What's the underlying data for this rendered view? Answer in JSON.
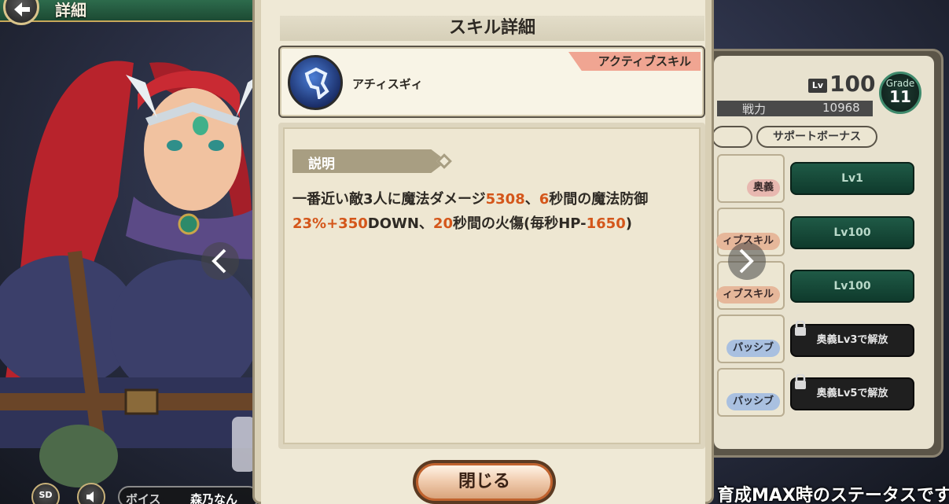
{
  "header": {
    "title": "詳細"
  },
  "modal": {
    "title": "スキル詳細",
    "skill": {
      "name": "アチィスギィ",
      "type": "アクティブスキル"
    },
    "description": {
      "header": "説明",
      "segments": [
        {
          "text": "一番近い敵3人に魔法ダメージ",
          "hl": false
        },
        {
          "text": "5308",
          "hl": true
        },
        {
          "text": "、",
          "hl": false
        },
        {
          "text": "6",
          "hl": true
        },
        {
          "text": "秒間の魔法防御",
          "hl": false
        },
        {
          "text": "23%+350",
          "hl": true
        },
        {
          "text": "DOWN、",
          "hl": false
        },
        {
          "text": "20",
          "hl": true
        },
        {
          "text": "秒間の火傷(毎秒HP-",
          "hl": false
        },
        {
          "text": "1650",
          "hl": true
        },
        {
          "text": ")",
          "hl": false
        }
      ]
    },
    "close_label": "閉じる"
  },
  "status": {
    "lv_tag": "Lv",
    "level": "100",
    "grade_label": "Grade",
    "grade": "11",
    "power_label": "戦力",
    "power": "10968",
    "tab_support": "サポートボーナス",
    "rows": [
      {
        "tag": "奥義",
        "tag_type": "ougi",
        "button": "Lv1",
        "locked": false
      },
      {
        "tag": "ィブスキル",
        "tag_type": "active",
        "button": "Lv100",
        "locked": false
      },
      {
        "tag": "ィブスキル",
        "tag_type": "active",
        "button": "Lv100",
        "locked": false
      },
      {
        "tag": "パッシブ",
        "tag_type": "passive",
        "button": "奥義Lv3で解放",
        "locked": true
      },
      {
        "tag": "パッシブ",
        "tag_type": "passive",
        "button": "奥義Lv5で解放",
        "locked": true
      }
    ],
    "bottom_note": "育成MAX時のステータスです"
  },
  "footer": {
    "sd_label": "SD",
    "voice_label": "ボイス",
    "voice_actor": "森乃なん"
  },
  "colors": {
    "highlight": "#d4561a",
    "modal_bg": "#efe9d6",
    "lv_button": "#1f5a46",
    "skill_type_banner": "#f0a592"
  },
  "icons": [
    "back-arrow-icon",
    "nav-left-icon",
    "nav-right-icon",
    "lock-icon",
    "speaker-icon",
    "skill-icon"
  ]
}
